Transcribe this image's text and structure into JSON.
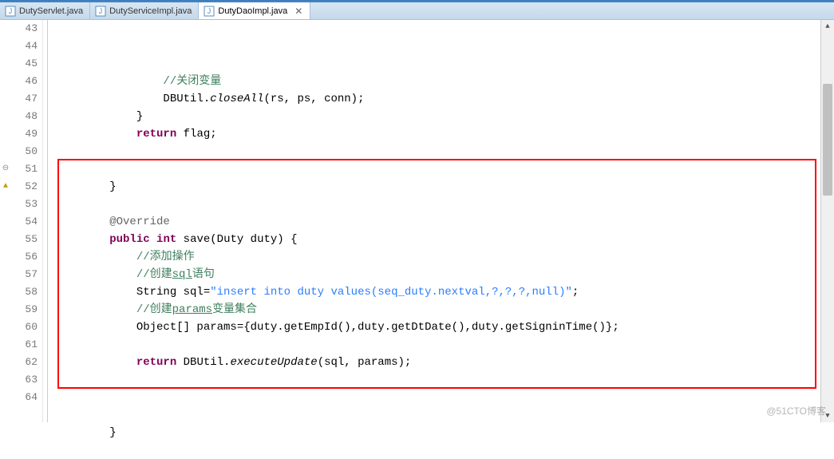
{
  "tabs": [
    {
      "label": "DutyServlet.java",
      "active": false,
      "closeable": false
    },
    {
      "label": "DutyServiceImpl.java",
      "active": false,
      "closeable": false
    },
    {
      "label": "DutyDaoImpl.java",
      "active": true,
      "closeable": true
    }
  ],
  "line_start": 43,
  "line_end": 64,
  "annotations": {
    "51": "expand",
    "52": "warning"
  },
  "code": {
    "l43": {
      "indent": "                ",
      "comment": "//关闭变量"
    },
    "l44": {
      "indent": "                ",
      "cls": "DBUtil",
      "dot": ".",
      "method": "closeAll",
      "args": "(rs, ps, conn);"
    },
    "l45": {
      "indent": "            ",
      "text": "}"
    },
    "l46": {
      "indent": "            ",
      "kw": "return",
      "rest": " flag;"
    },
    "l47": {
      "text": ""
    },
    "l48": {
      "text": ""
    },
    "l49": {
      "indent": "        ",
      "text": "}"
    },
    "l50": {
      "text": ""
    },
    "l51": {
      "indent": "        ",
      "ann": "@Override"
    },
    "l52": {
      "indent": "        ",
      "kw1": "public",
      "sp1": " ",
      "kw2": "int",
      "sp2": " ",
      "name": "save(Duty duty) {"
    },
    "l53": {
      "indent": "            ",
      "comment": "//添加操作"
    },
    "l54": {
      "indent": "            ",
      "cmt_pre": "//创建",
      "cmt_u": "sql",
      "cmt_post": "语句"
    },
    "l55": {
      "indent": "            ",
      "pre": "String sql=",
      "str": "\"insert into duty values(seq_duty.nextval,?,?,?,null)\"",
      "post": ";"
    },
    "l56": {
      "indent": "            ",
      "cmt_pre": "//创建",
      "cmt_u": "params",
      "cmt_post": "变量集合"
    },
    "l57": {
      "indent": "            ",
      "text": "Object[] params={duty.getEmpId(),duty.getDtDate(),duty.getSigninTime()};"
    },
    "l58": {
      "text": ""
    },
    "l59": {
      "indent": "            ",
      "kw": "return",
      "sp": " ",
      "cls": "DBUtil",
      "dot": ".",
      "method": "executeUpdate",
      "args": "(sql, params);"
    },
    "l60": {
      "text": ""
    },
    "l61": {
      "text": ""
    },
    "l62": {
      "text": ""
    },
    "l63": {
      "indent": "        ",
      "text": "}"
    },
    "l64": {
      "text": ""
    }
  },
  "highlight": {
    "top_line": 51,
    "bottom_line": 63
  },
  "watermark": "@51CTO博客"
}
